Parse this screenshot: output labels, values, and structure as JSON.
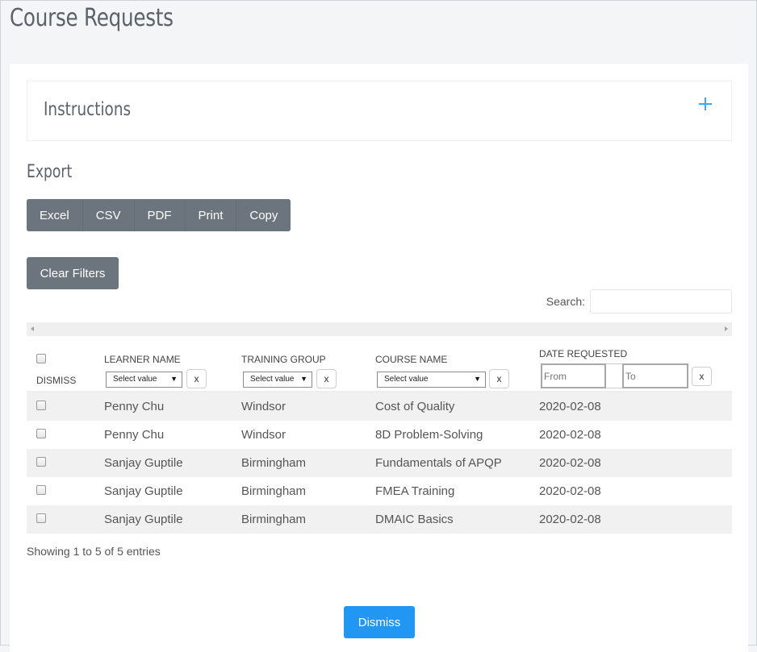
{
  "page": {
    "title": "Course Requests"
  },
  "instructions": {
    "title": "Instructions",
    "toggle_icon": "plus-icon"
  },
  "export": {
    "title": "Export",
    "buttons": [
      "Excel",
      "CSV",
      "PDF",
      "Print",
      "Copy"
    ]
  },
  "filters": {
    "clear_label": "Clear Filters"
  },
  "search": {
    "label": "Search:",
    "value": "",
    "placeholder": ""
  },
  "table": {
    "columns": {
      "dismiss": "DISMISS",
      "learner": "LEARNER NAME",
      "group": "TRAINING GROUP",
      "course": "COURSE NAME",
      "date": "DATE REQUESTED"
    },
    "column_filters": {
      "select_placeholder": "Select value",
      "caret": "▼",
      "clear": "x",
      "date_from_placeholder": "From",
      "date_to_placeholder": "To"
    },
    "rows": [
      {
        "learner": "Penny Chu",
        "group": "Windsor",
        "course": "Cost of Quality",
        "date": "2020-02-08",
        "checked": false
      },
      {
        "learner": "Penny Chu",
        "group": "Windsor",
        "course": "8D Problem-Solving",
        "date": "2020-02-08",
        "checked": false
      },
      {
        "learner": "Sanjay Guptile",
        "group": "Birmingham",
        "course": "Fundamentals of APQP",
        "date": "2020-02-08",
        "checked": false
      },
      {
        "learner": "Sanjay Guptile",
        "group": "Birmingham",
        "course": "FMEA Training",
        "date": "2020-02-08",
        "checked": false
      },
      {
        "learner": "Sanjay Guptile",
        "group": "Birmingham",
        "course": "DMAIC Basics",
        "date": "2020-02-08",
        "checked": false
      }
    ],
    "info": "Showing 1 to 5 of 5 entries"
  },
  "actions": {
    "dismiss_label": "Dismiss"
  },
  "colors": {
    "accent": "#2196f3",
    "plus_icon": "#42a5f5",
    "secondary_button": "#6c757d",
    "title_text": "#5a636c"
  }
}
